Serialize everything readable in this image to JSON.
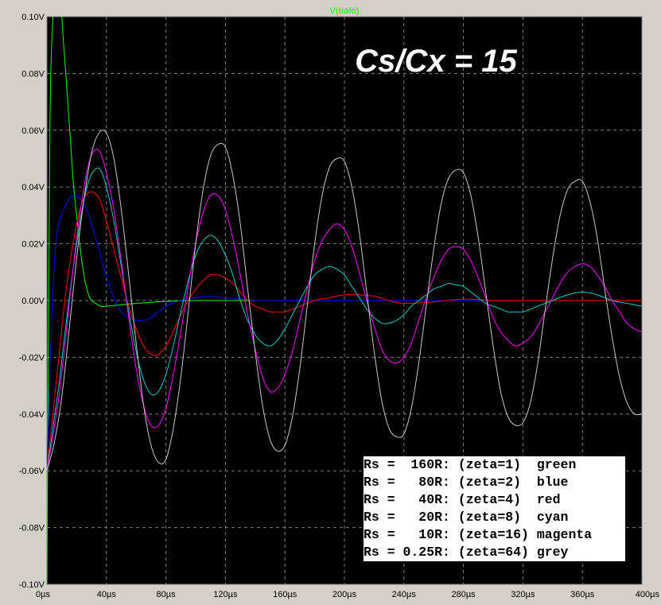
{
  "window": {
    "trace_name": "V(trafo)",
    "annotation": "Cs/Cx = 15"
  },
  "chart_data": {
    "type": "line",
    "title": "V(trafo)",
    "xlabel": "",
    "ylabel": "",
    "x_unit": "µs",
    "y_unit": "V",
    "xlim": [
      0,
      400
    ],
    "ylim": [
      -0.1,
      0.1
    ],
    "x_ticks": [
      0,
      40,
      80,
      120,
      160,
      200,
      240,
      280,
      320,
      360,
      400
    ],
    "x_tick_labels": [
      "0µs",
      "40µs",
      "80µs",
      "120µs",
      "160µs",
      "200µs",
      "240µs",
      "280µs",
      "320µs",
      "360µs",
      "400µs"
    ],
    "y_ticks": [
      0.1,
      0.08,
      0.06,
      0.04,
      0.02,
      0.0,
      -0.02,
      -0.04,
      -0.06,
      -0.08,
      -0.1
    ],
    "y_tick_labels": [
      "0.10V",
      "0.08V",
      "0.06V",
      "0.04V",
      "0.02V",
      "0.00V",
      "-0.02V",
      "-0.04V",
      "-0.06V",
      "-0.08V",
      "-0.10V"
    ],
    "grid": true,
    "background": "#000000",
    "legend_placement": "bottom-right",
    "series": [
      {
        "color": "#00ff00",
        "x": [
          0,
          2,
          4,
          6,
          8,
          10,
          12,
          14,
          16,
          18,
          20,
          22,
          24,
          26,
          28,
          30,
          33,
          36,
          40,
          50,
          60,
          80,
          100,
          120,
          160,
          200,
          240,
          280,
          320,
          360,
          400
        ],
        "y": [
          -0.1,
          0.06,
          0.1,
          0.13,
          0.125,
          0.1,
          0.085,
          0.07,
          0.055,
          0.04,
          0.03,
          0.02,
          0.012,
          0.006,
          0.002,
          0.0,
          -0.001,
          -0.002,
          -0.002,
          -0.0015,
          -0.001,
          -0.0003,
          0.0,
          0.0,
          0.0,
          0.0,
          0.0,
          0.0,
          0.0,
          0.0,
          0.0
        ]
      },
      {
        "color": "#0000ff",
        "x": [
          0,
          3,
          6,
          10,
          14,
          18,
          22,
          26,
          30,
          34,
          38,
          42,
          46,
          50,
          55,
          60,
          65,
          70,
          75,
          80,
          90,
          100,
          110,
          120,
          130,
          140,
          160,
          200,
          240,
          280,
          320,
          360,
          400
        ],
        "y": [
          -0.06,
          -0.01,
          0.02,
          0.03,
          0.035,
          0.037,
          0.036,
          0.033,
          0.027,
          0.02,
          0.012,
          0.005,
          0.0,
          -0.004,
          -0.006,
          -0.007,
          -0.007,
          -0.006,
          -0.004,
          -0.002,
          0.0,
          0.001,
          0.0015,
          0.001,
          0.0005,
          0.0,
          0.0,
          0.0,
          0.0,
          0.0,
          0.0,
          0.0,
          0.0
        ]
      },
      {
        "color": "#ff0000",
        "x": [
          0,
          4,
          8,
          12,
          16,
          20,
          24,
          28,
          32,
          36,
          40,
          45,
          50,
          55,
          60,
          65,
          70,
          75,
          80,
          85,
          90,
          95,
          100,
          105,
          110,
          115,
          120,
          125,
          130,
          135,
          140,
          145,
          150,
          155,
          160,
          170,
          180,
          190,
          200,
          210,
          220,
          230,
          240,
          260,
          280,
          300,
          320,
          360,
          400
        ],
        "y": [
          -0.06,
          -0.04,
          -0.02,
          0.0,
          0.015,
          0.027,
          0.035,
          0.038,
          0.038,
          0.035,
          0.028,
          0.018,
          0.008,
          -0.002,
          -0.01,
          -0.016,
          -0.019,
          -0.019,
          -0.016,
          -0.011,
          -0.005,
          0.0,
          0.004,
          0.007,
          0.009,
          0.009,
          0.008,
          0.006,
          0.003,
          0.0,
          -0.002,
          -0.003,
          -0.004,
          -0.004,
          -0.004,
          -0.002,
          0.0,
          0.001,
          0.002,
          0.002,
          0.0015,
          0.0,
          -0.001,
          -0.0005,
          0.0005,
          0.0,
          0.0,
          0.0,
          0.0
        ]
      },
      {
        "color": "#00cccc",
        "x": [
          0,
          4,
          8,
          12,
          16,
          20,
          24,
          28,
          32,
          36,
          40,
          45,
          50,
          55,
          60,
          65,
          70,
          75,
          80,
          85,
          90,
          95,
          100,
          105,
          110,
          115,
          120,
          125,
          130,
          135,
          140,
          145,
          150,
          155,
          160,
          165,
          170,
          175,
          180,
          185,
          190,
          195,
          200,
          205,
          210,
          215,
          220,
          225,
          230,
          235,
          240,
          245,
          250,
          255,
          260,
          265,
          270,
          275,
          280,
          285,
          290,
          295,
          300,
          305,
          310,
          315,
          320,
          330,
          340,
          350,
          360,
          370,
          380,
          390,
          400
        ],
        "y": [
          -0.06,
          -0.045,
          -0.03,
          -0.012,
          0.005,
          0.02,
          0.033,
          0.042,
          0.046,
          0.046,
          0.04,
          0.028,
          0.012,
          -0.004,
          -0.018,
          -0.028,
          -0.033,
          -0.032,
          -0.026,
          -0.016,
          -0.004,
          0.007,
          0.016,
          0.021,
          0.023,
          0.021,
          0.016,
          0.009,
          0.0,
          -0.007,
          -0.012,
          -0.015,
          -0.016,
          -0.014,
          -0.01,
          -0.005,
          0.0,
          0.005,
          0.009,
          0.011,
          0.012,
          0.011,
          0.009,
          0.005,
          0.001,
          -0.003,
          -0.006,
          -0.008,
          -0.008,
          -0.007,
          -0.005,
          -0.002,
          0.0,
          0.002,
          0.004,
          0.005,
          0.006,
          0.0055,
          0.005,
          0.003,
          0.001,
          -0.001,
          -0.002,
          -0.003,
          -0.004,
          -0.004,
          -0.004,
          -0.002,
          0.0,
          0.002,
          0.003,
          0.002,
          0.0,
          -0.001,
          -0.002
        ]
      },
      {
        "color": "#ff00ff",
        "x": [
          0,
          4,
          8,
          12,
          16,
          20,
          24,
          28,
          32,
          36,
          40,
          45,
          50,
          55,
          60,
          65,
          70,
          75,
          80,
          85,
          90,
          95,
          100,
          105,
          110,
          115,
          120,
          125,
          130,
          135,
          140,
          145,
          150,
          155,
          160,
          165,
          170,
          175,
          180,
          185,
          190,
          195,
          200,
          205,
          210,
          215,
          220,
          225,
          230,
          235,
          240,
          245,
          250,
          255,
          260,
          265,
          270,
          275,
          280,
          285,
          290,
          295,
          300,
          305,
          310,
          315,
          320,
          325,
          330,
          335,
          340,
          345,
          350,
          355,
          360,
          365,
          370,
          375,
          380,
          385,
          390,
          395,
          400
        ],
        "y": [
          -0.06,
          -0.048,
          -0.034,
          -0.016,
          0.004,
          0.022,
          0.037,
          0.048,
          0.053,
          0.052,
          0.045,
          0.032,
          0.014,
          -0.006,
          -0.024,
          -0.037,
          -0.044,
          -0.044,
          -0.038,
          -0.026,
          -0.011,
          0.005,
          0.02,
          0.031,
          0.037,
          0.037,
          0.032,
          0.022,
          0.009,
          -0.005,
          -0.017,
          -0.027,
          -0.032,
          -0.031,
          -0.026,
          -0.018,
          -0.007,
          0.004,
          0.014,
          0.021,
          0.025,
          0.027,
          0.025,
          0.019,
          0.01,
          0.0,
          -0.009,
          -0.017,
          -0.021,
          -0.022,
          -0.02,
          -0.015,
          -0.007,
          0.001,
          0.008,
          0.014,
          0.018,
          0.019,
          0.018,
          0.014,
          0.008,
          0.001,
          -0.006,
          -0.011,
          -0.014,
          -0.016,
          -0.015,
          -0.013,
          -0.009,
          -0.004,
          0.001,
          0.006,
          0.01,
          0.012,
          0.013,
          0.012,
          0.009,
          0.005,
          0.0,
          -0.004,
          -0.008,
          -0.01,
          -0.011
        ]
      },
      {
        "color": "#c8c8c8",
        "x": [
          0,
          5,
          10,
          15,
          20,
          25,
          30,
          35,
          40,
          45,
          50,
          55,
          60,
          65,
          70,
          75,
          80,
          85,
          90,
          95,
          100,
          105,
          110,
          115,
          120,
          125,
          130,
          135,
          140,
          145,
          150,
          155,
          160,
          165,
          170,
          175,
          180,
          185,
          190,
          195,
          200,
          205,
          210,
          215,
          220,
          225,
          230,
          235,
          240,
          245,
          250,
          255,
          260,
          265,
          270,
          275,
          280,
          285,
          290,
          295,
          300,
          305,
          310,
          315,
          320,
          325,
          330,
          335,
          340,
          345,
          350,
          355,
          360,
          365,
          370,
          375,
          380,
          385,
          390,
          395,
          400
        ],
        "y": [
          -0.06,
          -0.05,
          -0.034,
          -0.01,
          0.015,
          0.036,
          0.052,
          0.059,
          0.059,
          0.05,
          0.032,
          0.009,
          -0.015,
          -0.037,
          -0.051,
          -0.057,
          -0.056,
          -0.045,
          -0.027,
          -0.004,
          0.02,
          0.039,
          0.051,
          0.055,
          0.054,
          0.044,
          0.027,
          0.004,
          -0.018,
          -0.037,
          -0.049,
          -0.053,
          -0.051,
          -0.041,
          -0.024,
          -0.002,
          0.02,
          0.037,
          0.047,
          0.05,
          0.049,
          0.04,
          0.024,
          0.003,
          -0.018,
          -0.035,
          -0.045,
          -0.048,
          -0.047,
          -0.038,
          -0.022,
          -0.002,
          0.018,
          0.034,
          0.043,
          0.046,
          0.045,
          0.037,
          0.022,
          0.003,
          -0.016,
          -0.032,
          -0.041,
          -0.044,
          -0.043,
          -0.036,
          -0.022,
          -0.003,
          0.015,
          0.03,
          0.039,
          0.042,
          0.042,
          0.035,
          0.022,
          0.004,
          -0.013,
          -0.027,
          -0.036,
          -0.04,
          -0.04
        ]
      }
    ],
    "legend": [
      "Rs =  160R: (zeta=1)  green",
      "Rs =   80R: (zeta=2)  blue",
      "Rs =   40R: (zeta=4)  red",
      "Rs =   20R: (zeta=8)  cyan",
      "Rs =   10R: (zeta=16) magenta",
      "Rs = 0.25R: (zeta=64) grey"
    ]
  }
}
